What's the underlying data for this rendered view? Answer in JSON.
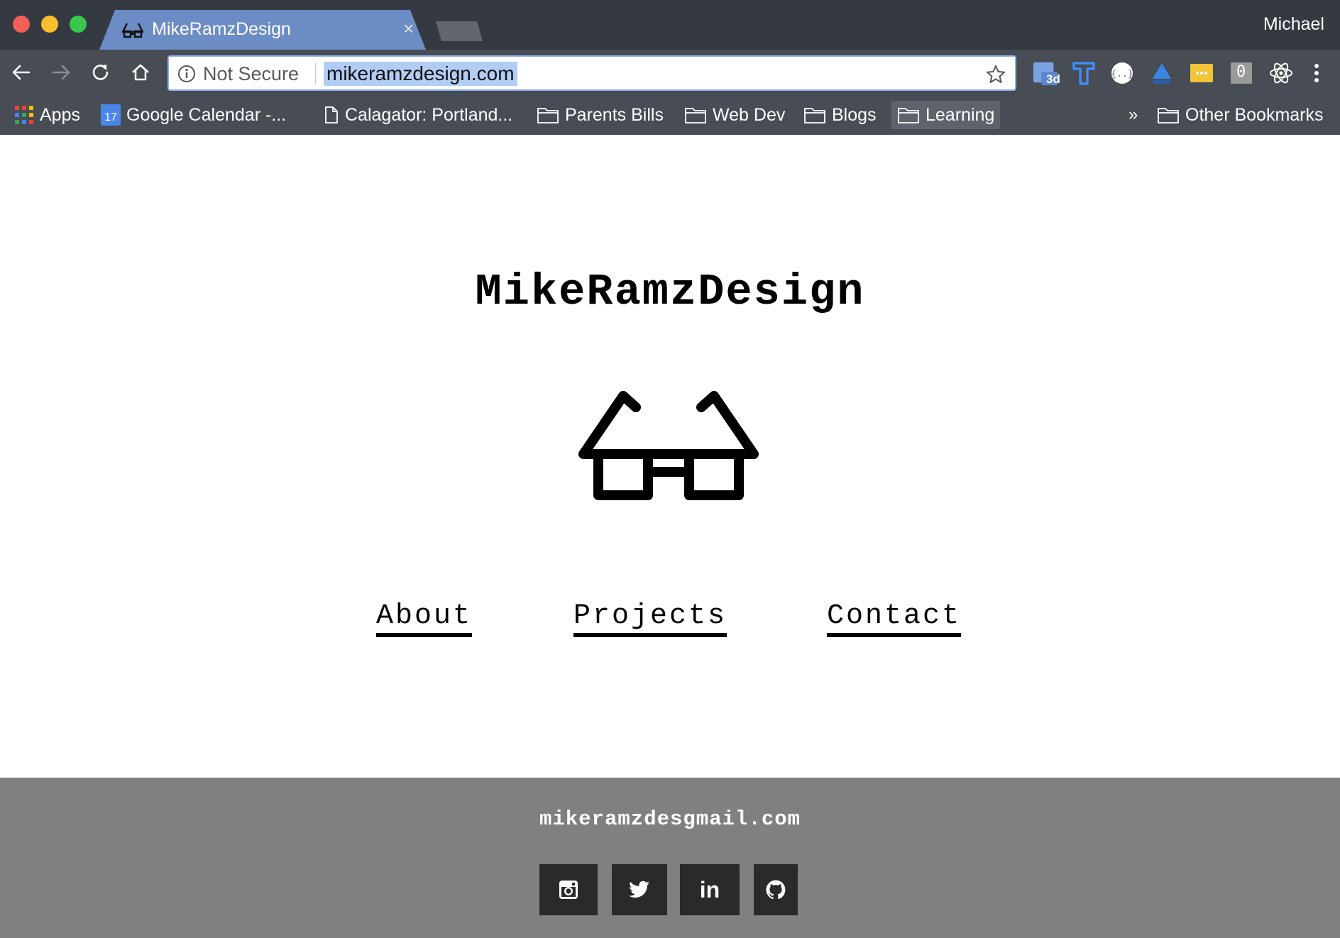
{
  "browser": {
    "tab": {
      "title": "MikeRamzDesign",
      "close_glyph": "×"
    },
    "profile_name": "Michael",
    "omnibox": {
      "security_label": "Not Secure",
      "url": "mikeramzdesign.com"
    },
    "bookmarks": [
      {
        "label": "Apps",
        "icon": "apps-grid-icon"
      },
      {
        "label": "Google Calendar -...",
        "icon": "calendar-icon",
        "icon_text": "17"
      },
      {
        "label": "Calagator: Portland...",
        "icon": "page-icon"
      },
      {
        "label": "Parents Bills",
        "icon": "folder-icon"
      },
      {
        "label": "Web Dev",
        "icon": "folder-icon"
      },
      {
        "label": "Blogs",
        "icon": "folder-icon"
      },
      {
        "label": "Learning",
        "icon": "folder-icon"
      }
    ],
    "overflow_glyph": "»",
    "other_bookmarks": "Other Bookmarks",
    "extensions": [
      "3d-extension-icon",
      "t-extension-icon",
      "json-extension-icon",
      "triangle-extension-icon",
      "dots-extension-icon",
      "zero-extension-icon",
      "react-extension-icon",
      "menu-icon"
    ],
    "extension_text": {
      "three_d": "3d",
      "zero": "0"
    }
  },
  "page": {
    "site_title": "MikeRamzDesign",
    "logo": "glasses-icon",
    "nav": {
      "about": "About",
      "projects": "Projects",
      "contact": "Contact"
    },
    "footer": {
      "email": "mikeramzdesgmail.com",
      "social": [
        "instagram-icon",
        "twitter-icon",
        "linkedin-icon",
        "github-icon"
      ],
      "linkedin_text": "in"
    }
  },
  "colors": {
    "chrome_dark": "#353941",
    "toolbar": "#474c55",
    "active_tab": "#6c8cc6",
    "url_highlight": "#b2cdf5",
    "footer_bg": "#808080",
    "social_btn": "#2a2a2a"
  }
}
